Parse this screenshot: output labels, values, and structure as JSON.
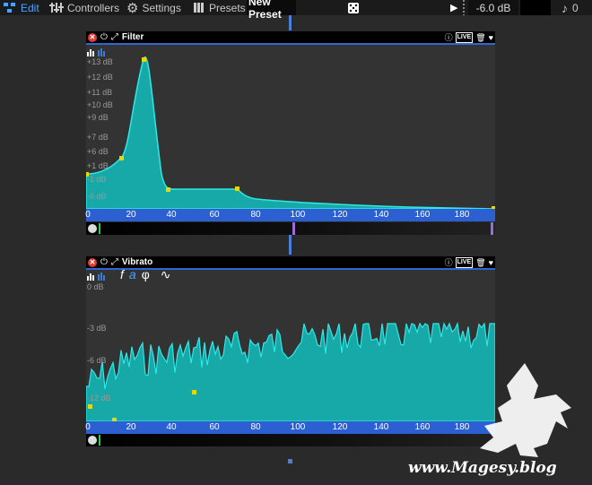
{
  "toolbar": {
    "edit": "Edit",
    "controllers": "Controllers",
    "settings": "Settings",
    "presets": "Presets",
    "preset_name": "New Preset",
    "volume": "-6.0 dB",
    "note_count": "0"
  },
  "filter": {
    "title": "Filter",
    "live": "LIVE",
    "db_labels": [
      "+13 dB",
      "+12 dB",
      "+11 dB",
      "+10 dB",
      "+9 dB",
      "+7 dB",
      "+6 dB",
      "+1 dB",
      "-1 dB",
      "-6 dB"
    ],
    "x_ticks": [
      "0",
      "20",
      "40",
      "60",
      "80",
      "100",
      "120",
      "140",
      "160",
      "180"
    ]
  },
  "vibrato": {
    "title": "Vibrato",
    "shape_buttons": [
      "f",
      "a",
      "φ",
      "∿"
    ],
    "live": "LIVE",
    "db_labels": [
      "0 dB",
      "-3 dB",
      "-6 dB",
      "-12 dB"
    ],
    "x_ticks": [
      "0",
      "20",
      "40",
      "60",
      "80",
      "100",
      "120",
      "140",
      "160",
      "180"
    ]
  },
  "watermark": "www.Magesy.blog"
}
